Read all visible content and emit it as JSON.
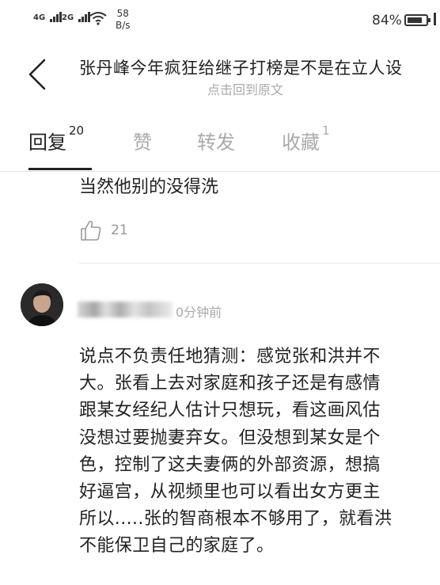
{
  "status_bar": {
    "signal1_label": "4G",
    "signal2_label": "2G",
    "speed_value": "58",
    "speed_unit": "B/s",
    "battery_percent": "84%",
    "battery_level": 0.84
  },
  "header": {
    "title": "张丹峰今年疯狂给继子打榜是不是在立人设",
    "subtitle": "点击回到原文"
  },
  "tabs": [
    {
      "label": "回复",
      "count": "20"
    },
    {
      "label": "赞",
      "count": ""
    },
    {
      "label": "转发",
      "count": ""
    },
    {
      "label": "收藏",
      "count": "1"
    }
  ],
  "previous_reply": {
    "text": "当然他别的没得洗",
    "like_count": "21"
  },
  "comment": {
    "time": "0分钟前",
    "lines": [
      "说点不负责任地猜测：感觉张和洪并不",
      "大。张看上去对家庭和孩子还是有感情",
      "跟某女经纪人估计只想玩，看这画风估",
      "没想过要抛妻弃女。但没想到某女是个",
      "色，控制了这夫妻俩的外部资源，想搞",
      "好逼宫，从视频里也可以看出女方更主",
      "所以.....张的智商根本不够用了，就看洪",
      "不能保卫自己的家庭了。"
    ]
  },
  "icons": {
    "back": "back-arrow-icon",
    "like": "thumbs-up-icon",
    "wifi": "wifi-icon",
    "battery": "battery-icon"
  }
}
